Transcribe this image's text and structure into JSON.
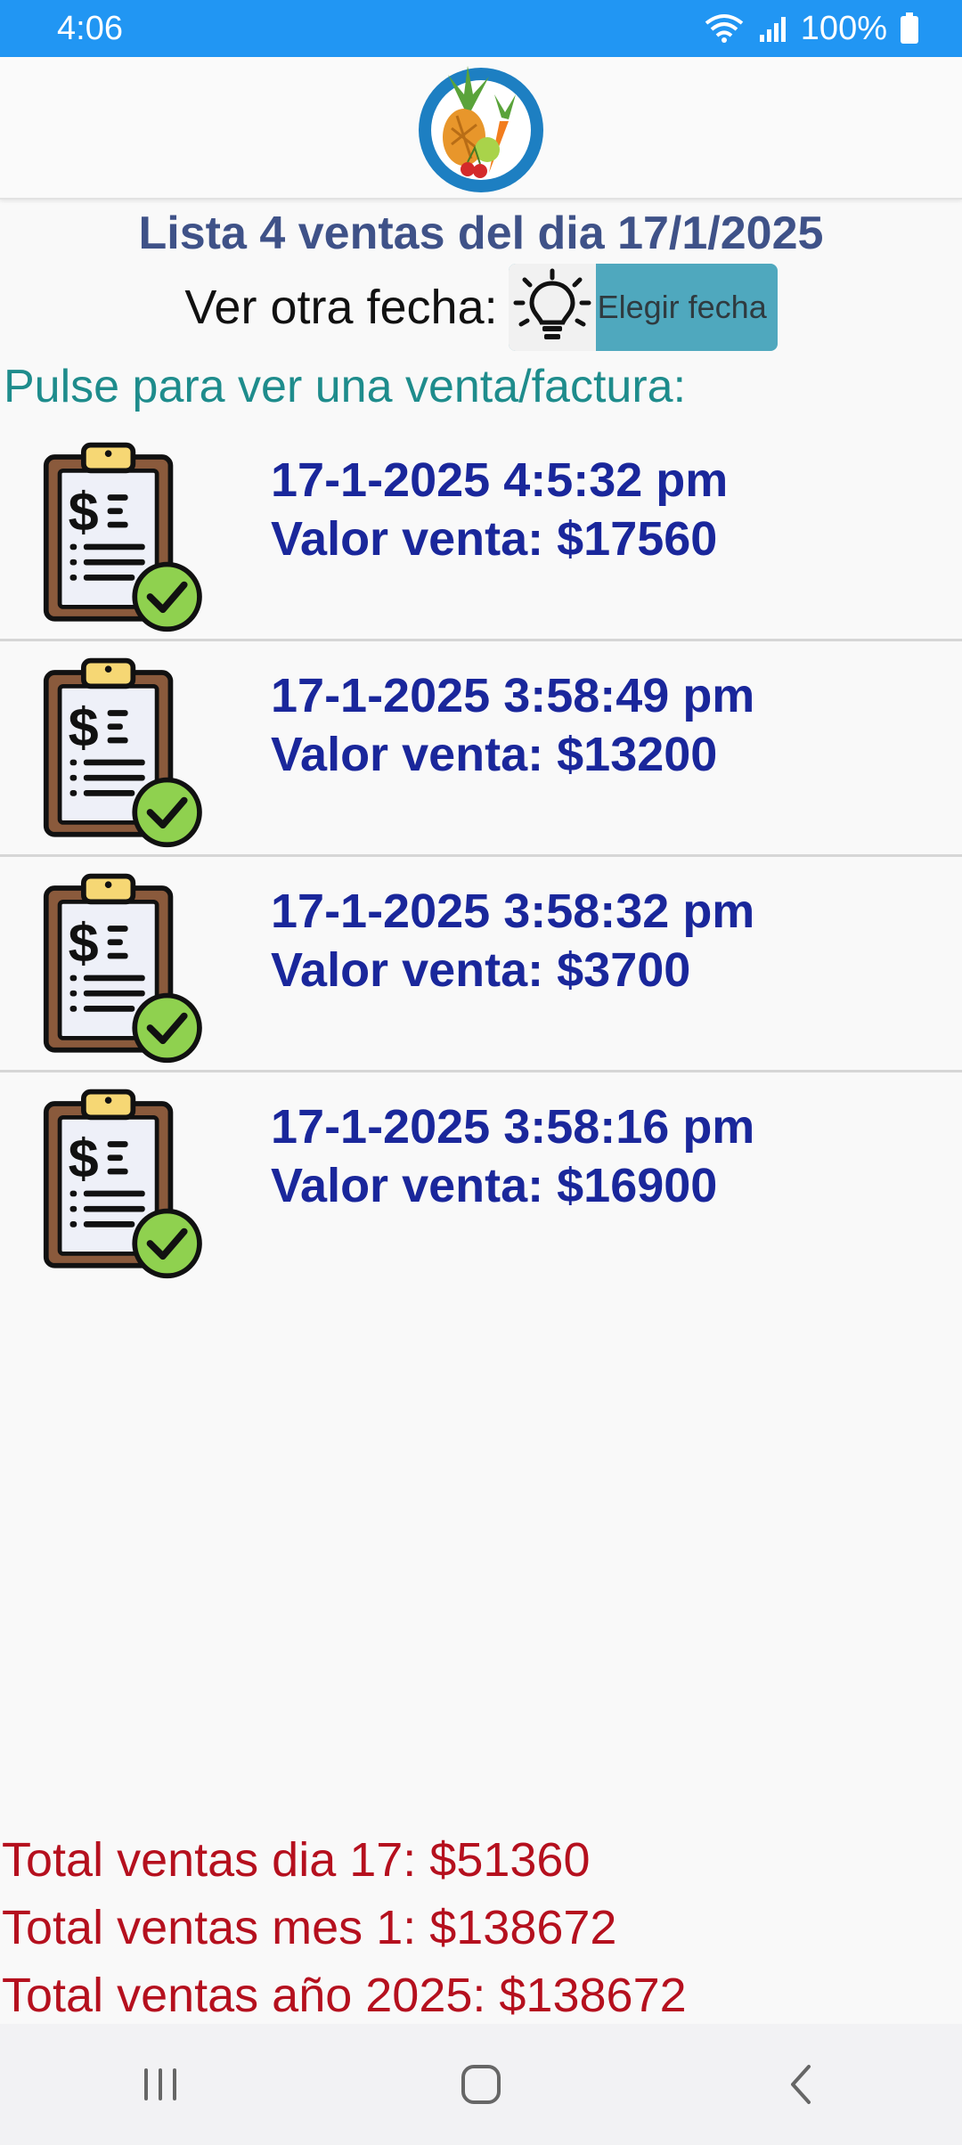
{
  "status_bar": {
    "time": "4:06",
    "battery": "100%"
  },
  "header": {
    "logo": "fruits-vegetables-logo"
  },
  "title": "Lista 4 ventas del dia 17/1/2025",
  "date_picker": {
    "label": "Ver otra fecha:",
    "button_label": "Elegir fecha",
    "icon": "lightbulb-icon"
  },
  "hint": "Pulse para ver una venta/factura:",
  "sales": [
    {
      "date": "17-1-2025 4:5:32 pm",
      "value": "Valor venta: $17560"
    },
    {
      "date": "17-1-2025 3:58:49 pm",
      "value": "Valor venta: $13200"
    },
    {
      "date": "17-1-2025 3:58:32 pm",
      "value": "Valor venta: $3700"
    },
    {
      "date": "17-1-2025 3:58:16 pm",
      "value": "Valor venta: $16900"
    }
  ],
  "totals": {
    "day": "Total ventas dia 17: $51360",
    "month": "Total ventas mes 1: $138672",
    "year": "Total ventas año 2025: $138672"
  },
  "colors": {
    "status_bar": "#2196f3",
    "title": "#3f5288",
    "hint": "#1e8c8c",
    "sale_text": "#1a279b",
    "totals": "#b5101e",
    "button": "#4fa8be"
  },
  "nav": {
    "recents": "recents-icon",
    "home": "home-icon",
    "back": "back-icon"
  }
}
